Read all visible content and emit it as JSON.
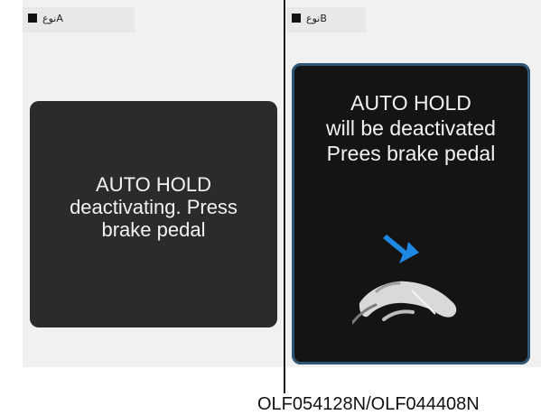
{
  "panels": [
    {
      "tab_label": "نوعA",
      "display_lines": [
        "AUTO HOLD",
        "deactivating. Press",
        "brake pedal"
      ]
    },
    {
      "tab_label": "نوعB",
      "display_lines": [
        "AUTO HOLD",
        "will be deactivated",
        "Prees brake pedal"
      ]
    }
  ],
  "caption": "OLF054128N/OLF044408N",
  "colors": {
    "display_background_a": "#2b2b2b",
    "display_background_b": "#141414",
    "arrow": "#1e88e5",
    "pedal": "#d9d9d9"
  },
  "icons": [
    "black-square-icon",
    "foot-on-pedal-icon",
    "blue-arrow-icon"
  ]
}
